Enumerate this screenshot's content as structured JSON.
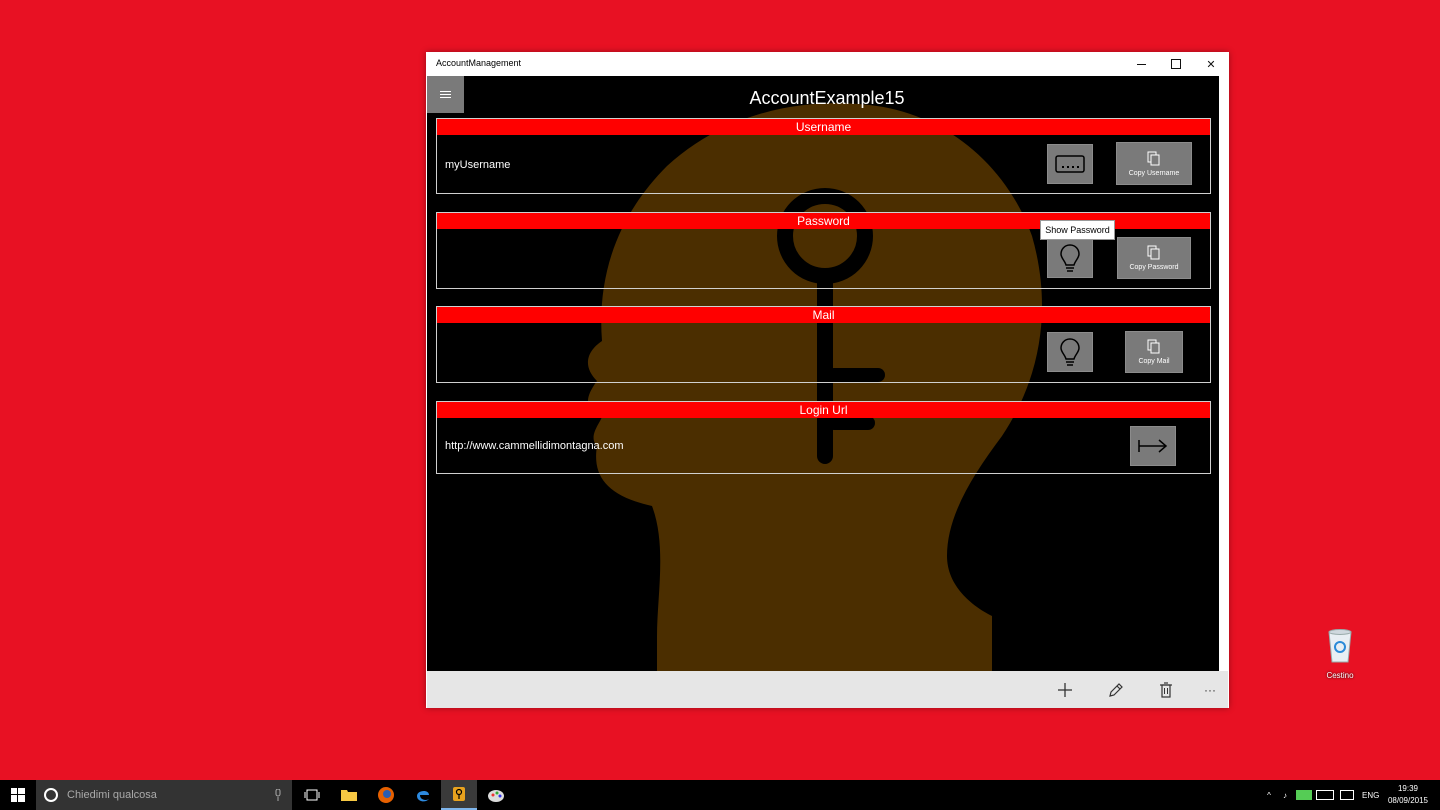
{
  "window": {
    "title": "AccountManagement",
    "close_glyph": "✕"
  },
  "app": {
    "title": "AccountExample15",
    "menu_icon": "hamburger-icon"
  },
  "sections": {
    "username": {
      "header": "Username",
      "value": "myUsername",
      "copy_label": "Copy Username"
    },
    "password": {
      "header": "Password",
      "value": "",
      "copy_label": "Copy Password",
      "tooltip": "Show Password"
    },
    "mail": {
      "header": "Mail",
      "value": "",
      "copy_label": "Copy Mail"
    },
    "login_url": {
      "header": "Login Url",
      "value": "http://www.cammellidimontagna.com"
    }
  },
  "command_bar": {
    "more_label": "···"
  },
  "desktop": {
    "recycle_bin_label": "Cestino"
  },
  "taskbar": {
    "search_placeholder": "Chiedimi qualcosa",
    "language": "ENG",
    "time": "19:39",
    "date": "08/09/2015"
  },
  "colors": {
    "desktop": "#E81123",
    "header_red": "#FF0000",
    "art_brown": "#4B2E00",
    "button_gray": "#7A7A7A"
  }
}
